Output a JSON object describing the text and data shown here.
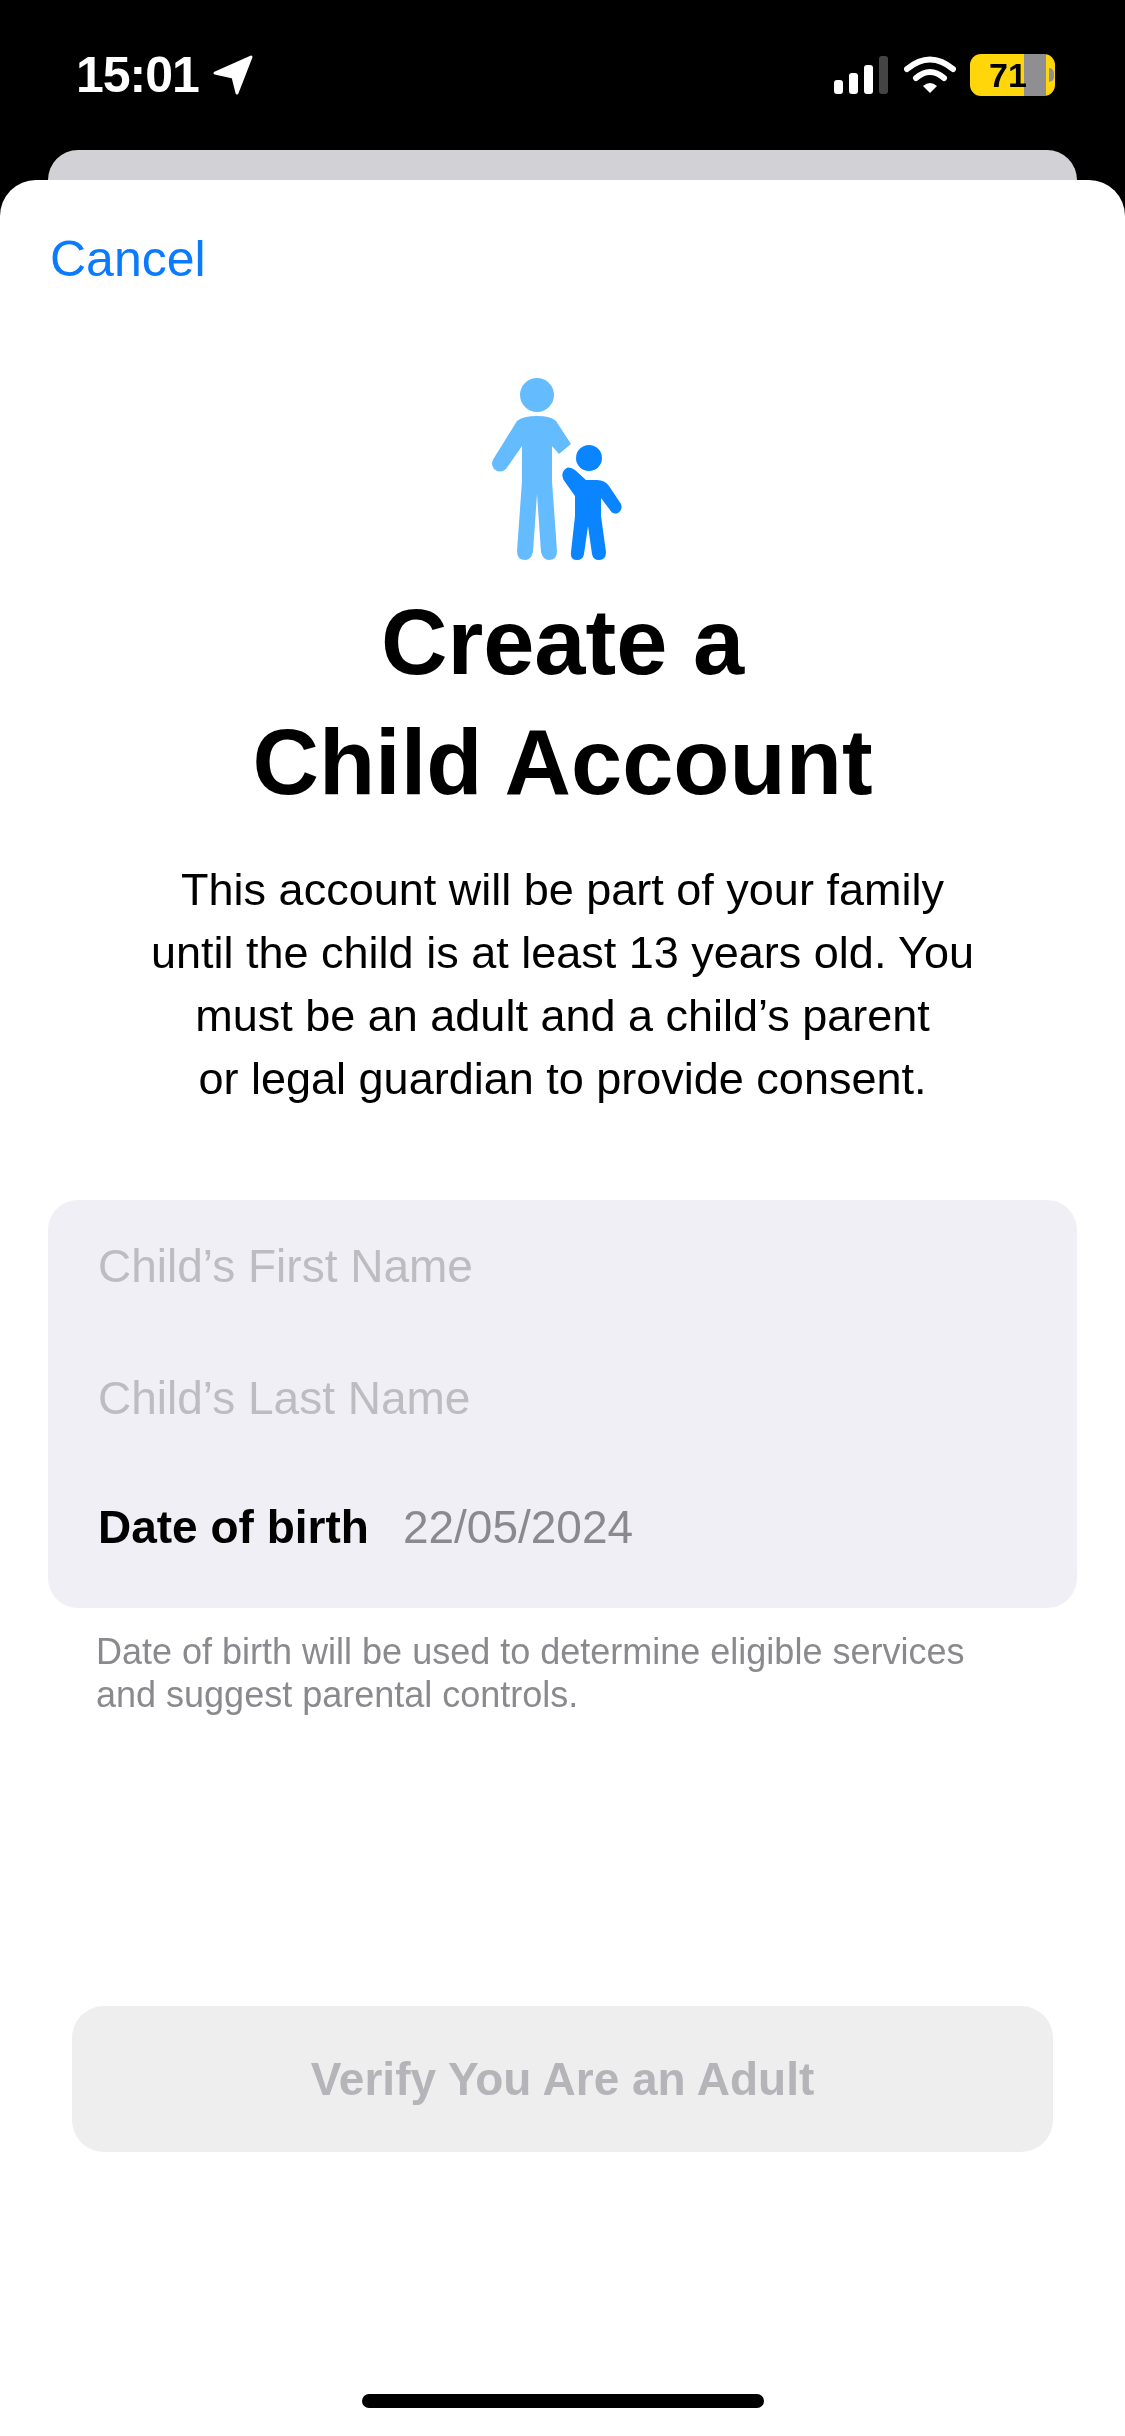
{
  "status_bar": {
    "time": "15:01",
    "battery": "71"
  },
  "cancel": "Cancel",
  "title": "Create a\nChild Account",
  "description": "This account will be part of your family\nuntil the child is at least 13 years old. You\nmust be an adult and a child’s parent\nor legal guardian to provide consent.",
  "form": {
    "first_name": {
      "placeholder": "Child’s First Name"
    },
    "last_name": {
      "placeholder": "Child’s Last Name"
    },
    "date_of_birth": {
      "label": "Date of birth",
      "value": "22/05/2024"
    }
  },
  "footnote": "Date of birth will be used to determine eligible services\nand suggest parental controls.",
  "button": {
    "label": "Verify You Are an Adult",
    "disabled": true
  }
}
